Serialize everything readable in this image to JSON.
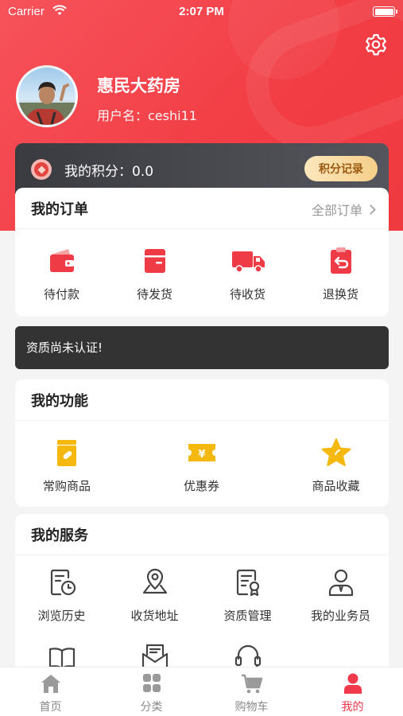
{
  "status_bar": {
    "carrier": "Carrier",
    "time": "2:07 PM"
  },
  "profile": {
    "store_name": "惠民大药房",
    "username": "用户名：ceshi11"
  },
  "points": {
    "label": "我的积分：0.0",
    "record_button": "积分记录"
  },
  "orders": {
    "title": "我的订单",
    "all_orders": "全部订单",
    "items": [
      {
        "label": "待付款",
        "icon": "wallet-icon"
      },
      {
        "label": "待发货",
        "icon": "shipping-box-icon"
      },
      {
        "label": "待收货",
        "icon": "delivery-truck-icon"
      },
      {
        "label": "退换货",
        "icon": "return-clipboard-icon"
      }
    ]
  },
  "notice": {
    "text": "资质尚未认证!"
  },
  "functions": {
    "title": "我的功能",
    "items": [
      {
        "label": "常购商品",
        "icon": "medicine-box-icon"
      },
      {
        "label": "优惠券",
        "icon": "coupon-icon"
      },
      {
        "label": "商品收藏",
        "icon": "star-icon"
      }
    ]
  },
  "services": {
    "title": "我的服务",
    "items": [
      {
        "label": "浏览历史",
        "icon": "history-icon"
      },
      {
        "label": "收货地址",
        "icon": "location-icon"
      },
      {
        "label": "资质管理",
        "icon": "certificate-icon"
      },
      {
        "label": "我的业务员",
        "icon": "salesperson-icon"
      },
      {
        "label": "",
        "icon": "book-icon"
      },
      {
        "label": "",
        "icon": "mail-icon"
      },
      {
        "label": "",
        "icon": "headset-icon"
      }
    ]
  },
  "tabbar": {
    "items": [
      {
        "label": "首页",
        "icon": "home-icon",
        "active": false
      },
      {
        "label": "分类",
        "icon": "category-icon",
        "active": false
      },
      {
        "label": "购物车",
        "icon": "cart-icon",
        "active": false
      },
      {
        "label": "我的",
        "icon": "user-icon",
        "active": true
      }
    ]
  },
  "colors": {
    "brand_red": "#f2434a",
    "tab_active": "#f0394a",
    "icon_yellow": "#f5b80f",
    "card_dark": "#333333"
  }
}
